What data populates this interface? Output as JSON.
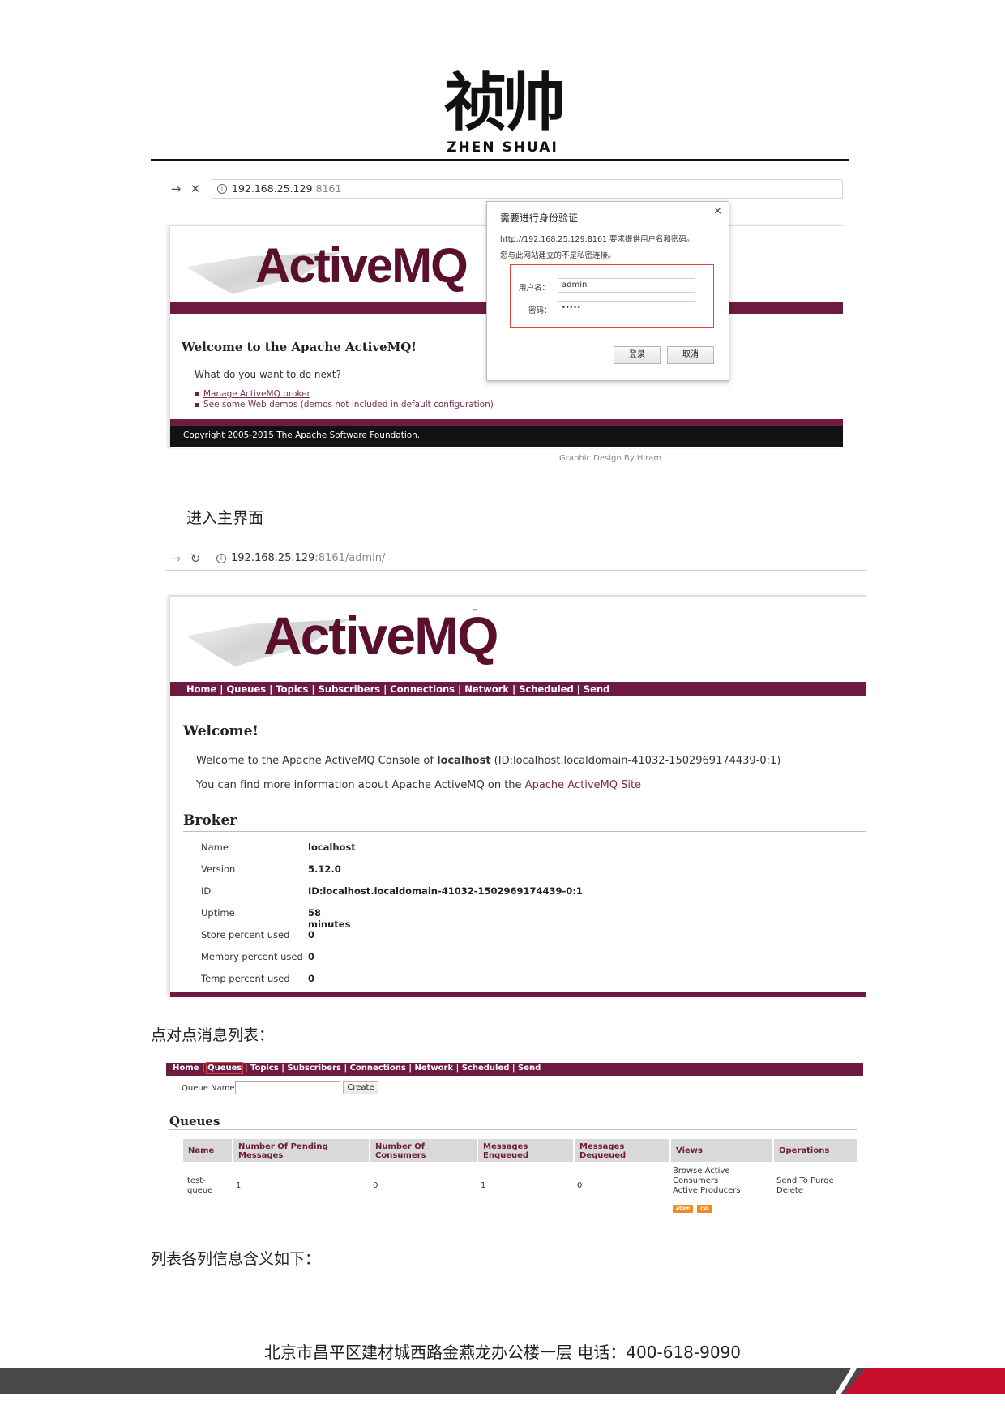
{
  "header": {
    "logo_cn": "祯帅",
    "logo_en": "ZHEN SHUAI"
  },
  "shot1": {
    "address_host": "192.168.25.129",
    "address_port": ":8161",
    "logo": "ActiveMQ",
    "welcome_title": "Welcome to the Apache ActiveMQ!",
    "question": "What do you want to do next?",
    "links": [
      "Manage ActiveMQ broker",
      "See some Web demos (demos not included in default configuration)"
    ],
    "copyright": "Copyright 2005-2015 The Apache Software Foundation.",
    "design_credit": "Graphic Design By Hiram",
    "dialog": {
      "title": "需要进行身份验证",
      "line1": "http://192.168.25.129:8161 要求提供用户名和密码。",
      "line2": "您与此网站建立的不是私密连接。",
      "user_label": "用户名：",
      "user_value": "admin",
      "pass_label": "密码：",
      "pass_value": "•••••",
      "ok": "登录",
      "cancel": "取消",
      "close": "×"
    }
  },
  "text_enter_main": "进入主界面",
  "shot2": {
    "address_host": "192.168.25.129",
    "address_port": ":8161/admin/",
    "logo": "ActiveMQ",
    "tm": "™",
    "menu": "Home | Queues | Topics | Subscribers | Connections | Network | Scheduled | Send",
    "welcome_heading": "Welcome!",
    "welcome_line_prefix": "Welcome to the Apache ActiveMQ Console of ",
    "welcome_host": "localhost",
    "welcome_id": " (ID:localhost.localdomain-41032-1502969174439-0:1)",
    "info_prefix": "You can find more information about Apache ActiveMQ on the ",
    "info_link": "Apache ActiveMQ Site",
    "broker_heading": "Broker",
    "broker": [
      {
        "k": "Name",
        "v": "localhost"
      },
      {
        "k": "Version",
        "v": "5.12.0"
      },
      {
        "k": "ID",
        "v": "ID:localhost.localdomain-41032-1502969174439-0:1"
      },
      {
        "k": "Uptime",
        "v": "58 minutes"
      },
      {
        "k": "Store percent used",
        "v": "0"
      },
      {
        "k": "Memory percent used",
        "v": "0"
      },
      {
        "k": "Temp percent used",
        "v": "0"
      }
    ]
  },
  "text_p2p": "点对点消息列表：",
  "shot3": {
    "menu": {
      "home": "Home",
      "queues": "Queues",
      "rest": "Topics | Subscribers | Connections | Network | Scheduled | Send"
    },
    "queue_name_label": "Queue Name",
    "create": "Create",
    "queues_heading": "Queues",
    "headers": [
      "Name",
      "Number Of Pending Messages",
      "Number Of Consumers",
      "Messages Enqueued",
      "Messages Dequeued",
      "Views",
      "Operations"
    ],
    "row": {
      "name": "test-queue",
      "pending": "1",
      "consumers": "0",
      "enqueued": "1",
      "dequeued": "0",
      "views": [
        "Browse Active Consumers",
        "Active Producers"
      ],
      "feeds": [
        "atom",
        "rss"
      ],
      "ops": [
        "Send To",
        "Purge",
        "Delete"
      ]
    }
  },
  "text_columns": "列表各列信息含义如下：",
  "footer": {
    "address": "北京市昌平区建材城西路金燕龙办公楼一层   电话：400-618-9090"
  }
}
